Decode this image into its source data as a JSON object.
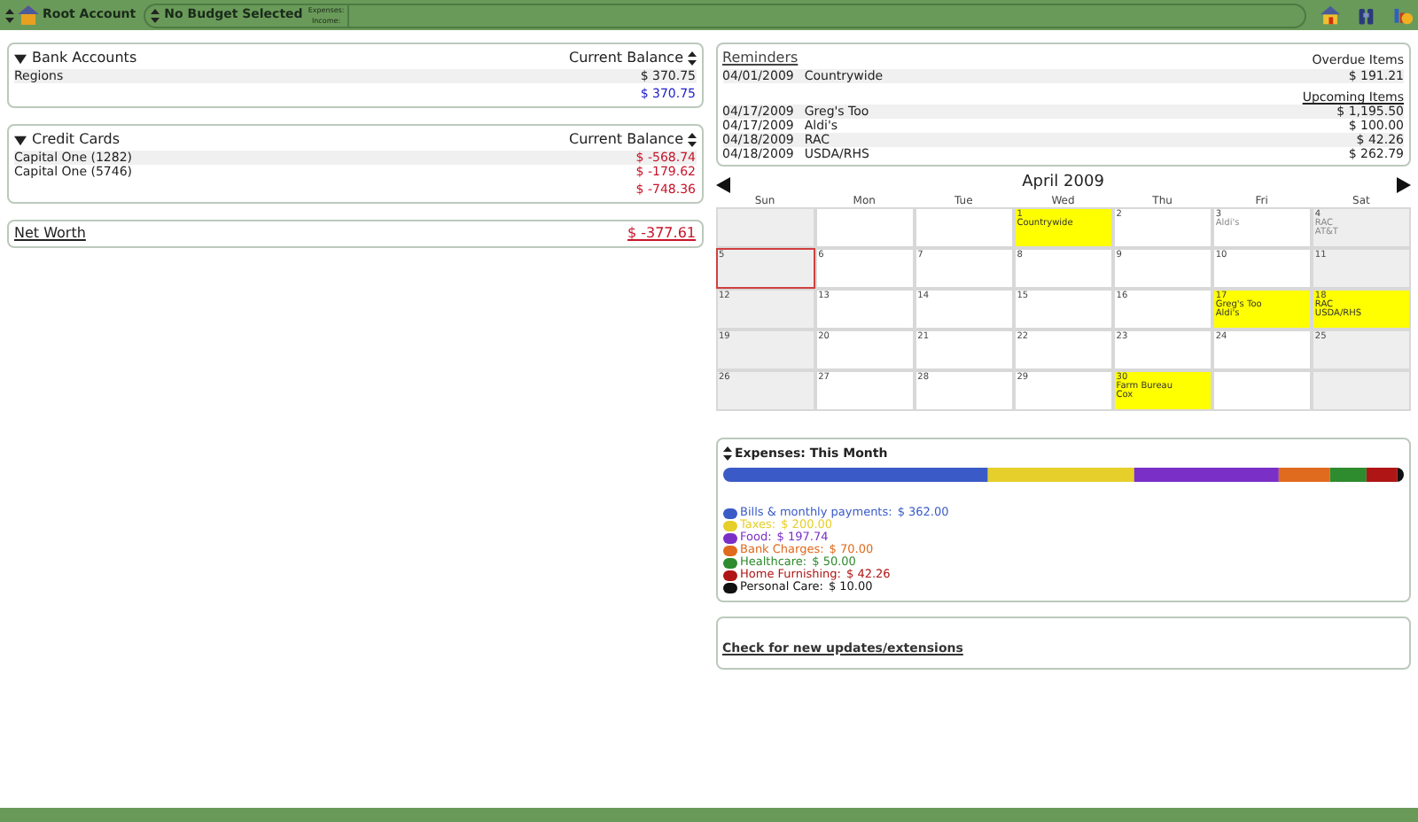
{
  "toolbar": {
    "account": "Root Account",
    "budget": "No Budget Selected",
    "budget_lines": [
      "Expenses:",
      "Income:"
    ]
  },
  "bank_accounts": {
    "title": "Bank Accounts",
    "expanded": true,
    "column": "Current Balance",
    "rows": [
      {
        "name": "Regions",
        "amount": "$ 370.75"
      }
    ],
    "total": "$ 370.75"
  },
  "credit_cards": {
    "title": "Credit Cards",
    "expanded": true,
    "column": "Current Balance",
    "rows": [
      {
        "name": "Capital One (1282)",
        "amount": "$ -568.74"
      },
      {
        "name": "Capital One (5746)",
        "amount": "$ -179.62"
      }
    ],
    "total": "$ -748.36"
  },
  "net_worth": {
    "label": "Net Worth",
    "amount": "$ -377.61"
  },
  "reminders": {
    "title": "Reminders",
    "overdue_heading": "Overdue Items",
    "overdue": [
      {
        "date": "04/01/2009",
        "name": "Countrywide",
        "amount": "$ 191.21"
      }
    ],
    "upcoming_heading": "Upcoming Items",
    "upcoming": [
      {
        "date": "04/17/2009",
        "name": "Greg's Too",
        "amount": "$ 1,195.50"
      },
      {
        "date": "04/17/2009",
        "name": "Aldi's",
        "amount": "$ 100.00"
      },
      {
        "date": "04/18/2009",
        "name": "RAC",
        "amount": "$ 42.26"
      },
      {
        "date": "04/18/2009",
        "name": "USDA/RHS",
        "amount": "$ 262.79"
      }
    ]
  },
  "calendar": {
    "title": "April 2009",
    "weekdays": [
      "Sun",
      "Mon",
      "Tue",
      "Wed",
      "Thu",
      "Fri",
      "Sat"
    ],
    "weeks": [
      [
        {
          "kind": "blank"
        },
        {
          "kind": "blank"
        },
        {
          "kind": "blank"
        },
        {
          "kind": "day",
          "day": "1",
          "entries": [
            "Countrywide"
          ],
          "highlighted": true,
          "today": false
        },
        {
          "kind": "day",
          "day": "2",
          "highlighted": false,
          "today": false
        },
        {
          "kind": "day",
          "day": "3",
          "entries": [
            "Aldi's"
          ],
          "highlighted": false,
          "today": false
        },
        {
          "kind": "day",
          "day": "4",
          "entries": [
            "RAC",
            "AT&T"
          ],
          "highlighted": false,
          "today": false
        }
      ],
      [
        {
          "kind": "day",
          "day": "5",
          "highlighted": false,
          "today": true
        },
        {
          "kind": "day",
          "day": "6",
          "highlighted": false,
          "today": false
        },
        {
          "kind": "day",
          "day": "7",
          "highlighted": false,
          "today": false
        },
        {
          "kind": "day",
          "day": "8",
          "highlighted": false,
          "today": false
        },
        {
          "kind": "day",
          "day": "9",
          "highlighted": false,
          "today": false
        },
        {
          "kind": "day",
          "day": "10",
          "highlighted": false,
          "today": false
        },
        {
          "kind": "day",
          "day": "11",
          "highlighted": false,
          "today": false
        }
      ],
      [
        {
          "kind": "day",
          "day": "12",
          "highlighted": false,
          "today": false
        },
        {
          "kind": "day",
          "day": "13",
          "highlighted": false,
          "today": false
        },
        {
          "kind": "day",
          "day": "14",
          "highlighted": false,
          "today": false
        },
        {
          "kind": "day",
          "day": "15",
          "highlighted": false,
          "today": false
        },
        {
          "kind": "day",
          "day": "16",
          "highlighted": false,
          "today": false
        },
        {
          "kind": "day",
          "day": "17",
          "entries": [
            "Greg's Too",
            "Aldi's"
          ],
          "highlighted": true,
          "today": false
        },
        {
          "kind": "day",
          "day": "18",
          "entries": [
            "RAC",
            "USDA/RHS"
          ],
          "highlighted": true,
          "today": false
        }
      ],
      [
        {
          "kind": "day",
          "day": "19",
          "highlighted": false,
          "today": false
        },
        {
          "kind": "day",
          "day": "20",
          "highlighted": false,
          "today": false
        },
        {
          "kind": "day",
          "day": "21",
          "highlighted": false,
          "today": false
        },
        {
          "kind": "day",
          "day": "22",
          "highlighted": false,
          "today": false
        },
        {
          "kind": "day",
          "day": "23",
          "highlighted": false,
          "today": false
        },
        {
          "kind": "day",
          "day": "24",
          "highlighted": false,
          "today": false
        },
        {
          "kind": "day",
          "day": "25",
          "highlighted": false,
          "today": false
        }
      ],
      [
        {
          "kind": "day",
          "day": "26",
          "highlighted": false,
          "today": false
        },
        {
          "kind": "day",
          "day": "27",
          "highlighted": false,
          "today": false
        },
        {
          "kind": "day",
          "day": "28",
          "highlighted": false,
          "today": false
        },
        {
          "kind": "day",
          "day": "29",
          "highlighted": false,
          "today": false
        },
        {
          "kind": "day",
          "day": "30",
          "entries": [
            "Farm Bureau",
            "Cox"
          ],
          "highlighted": true,
          "today": false
        },
        {
          "kind": "blank"
        },
        {
          "kind": "blank"
        }
      ]
    ]
  },
  "expenses": {
    "title": "Expenses: This Month",
    "categories": [
      {
        "label": "Bills & monthly payments:",
        "amount": "$ 362.00",
        "color": "#3a5bc7"
      },
      {
        "label": "Taxes:",
        "amount": "$ 200.00",
        "color": "#e6cf2a"
      },
      {
        "label": "Food:",
        "amount": "$ 197.74",
        "color": "#7a2fc7"
      },
      {
        "label": "Bank Charges:",
        "amount": "$ 70.00",
        "color": "#e06a1e"
      },
      {
        "label": "Healthcare:",
        "amount": "$ 50.00",
        "color": "#2e8b2e"
      },
      {
        "label": "Home Furnishing:",
        "amount": "$ 42.26",
        "color": "#b01515"
      },
      {
        "label": "Personal Care:",
        "amount": "$ 10.00",
        "color": "#111111"
      }
    ]
  },
  "updates_link": "Check for new updates/extensions"
}
